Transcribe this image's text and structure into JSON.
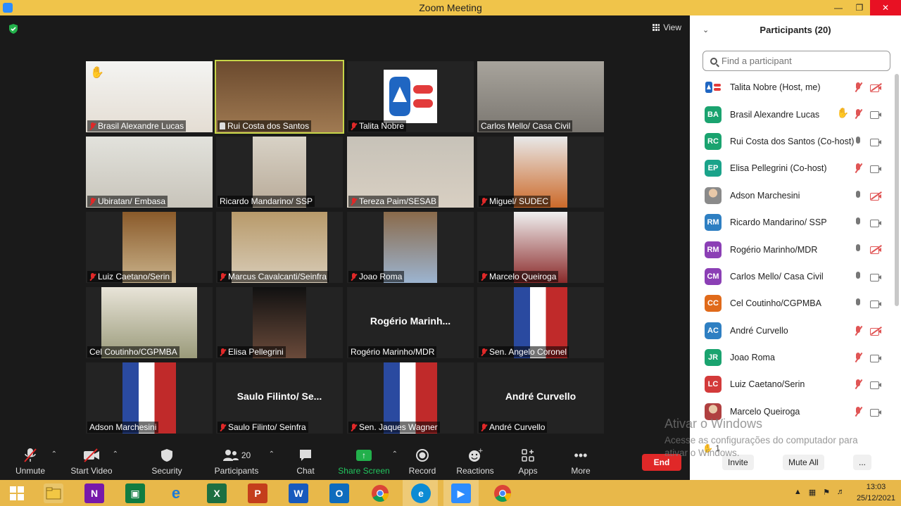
{
  "window": {
    "title": "Zoom Meeting"
  },
  "view_label": "View",
  "tiles": [
    {
      "name": "Brasil Alexandre Lucas",
      "muted": true,
      "hand": true
    },
    {
      "name": "Rui Costa dos Santos",
      "muted": false,
      "pinned": true,
      "active": true
    },
    {
      "name": "Talita Nobre",
      "muted": true,
      "logo": true
    },
    {
      "name": "Carlos Mello/ Casa Civil",
      "muted": false
    },
    {
      "name": "Ubiratan/ Embasa",
      "muted": true
    },
    {
      "name": "Ricardo Mandarino/ SSP",
      "muted": false
    },
    {
      "name": "Tereza Paim/SESAB",
      "muted": true
    },
    {
      "name": "Miguel/ SUDEC",
      "muted": true
    },
    {
      "name": "Luiz Caetano/Serin",
      "muted": true
    },
    {
      "name": "Marcus Cavalcanti/Seinfra",
      "muted": true
    },
    {
      "name": "Joao Roma",
      "muted": true
    },
    {
      "name": "Marcelo Queiroga",
      "muted": true
    },
    {
      "name": "Cel Coutinho/CGPMBA",
      "muted": false
    },
    {
      "name": "Elisa Pellegrini",
      "muted": true
    },
    {
      "name": "Rogério Marinho/MDR",
      "muted": false,
      "big_name": "Rogério  Marinh..."
    },
    {
      "name": "Sen. Angelo Coronel",
      "muted": true
    },
    {
      "name": "Adson Marchesini",
      "muted": false
    },
    {
      "name": "Saulo Filinto/ Seinfra",
      "muted": true,
      "big_name": "Saulo  Filinto/  Se..."
    },
    {
      "name": "Sen. Jaques Wagner",
      "muted": true
    },
    {
      "name": "André Curvello",
      "muted": true,
      "big_name": "André Curvello"
    }
  ],
  "toolbar": {
    "unmute": "Unmute",
    "start_video": "Start Video",
    "security": "Security",
    "participants": "Participants",
    "participants_count": "20",
    "chat": "Chat",
    "share_screen": "Share Screen",
    "record": "Record",
    "reactions": "Reactions",
    "apps": "Apps",
    "more": "More",
    "end": "End"
  },
  "panel": {
    "title": "Participants (20)",
    "search_placeholder": "Find a participant",
    "invite": "Invite",
    "mute_all": "Mute All",
    "more": "...",
    "raised_count": "1",
    "participants": [
      {
        "initials": "",
        "name": "Talita Nobre (Host, me)",
        "color": "#1f5fbf",
        "logo": true,
        "mic": "off",
        "cam": "off"
      },
      {
        "initials": "BA",
        "name": "Brasil Alexandre Lucas",
        "color": "#1aa36f",
        "hand": true,
        "mic": "off",
        "cam": "on"
      },
      {
        "initials": "RC",
        "name": "Rui Costa dos Santos (Co-host)",
        "color": "#1aa36f",
        "mic": "on",
        "cam": "on"
      },
      {
        "initials": "EP",
        "name": "Elisa Pellegrini (Co-host)",
        "color": "#1aa38a",
        "mic": "off",
        "cam": "on"
      },
      {
        "initials": "",
        "name": "Adson Marchesini",
        "color": "#8a8a8a",
        "photo": true,
        "mic": "on",
        "cam": "off"
      },
      {
        "initials": "RM",
        "name": "Ricardo Mandarino/ SSP",
        "color": "#2e7fc2",
        "mic": "on",
        "cam": "on"
      },
      {
        "initials": "RM",
        "name": "Rogério Marinho/MDR",
        "color": "#8b3fb5",
        "mic": "on",
        "cam": "off"
      },
      {
        "initials": "CM",
        "name": "Carlos Mello/ Casa Civil",
        "color": "#8b3fb5",
        "mic": "on",
        "cam": "on"
      },
      {
        "initials": "CC",
        "name": "Cel Coutinho/CGPMBA",
        "color": "#e06a1a",
        "mic": "on",
        "cam": "on"
      },
      {
        "initials": "AC",
        "name": "André Curvello",
        "color": "#2e7fc2",
        "mic": "off",
        "cam": "off"
      },
      {
        "initials": "JR",
        "name": "Joao Roma",
        "color": "#1aa36f",
        "mic": "off",
        "cam": "on"
      },
      {
        "initials": "LC",
        "name": "Luiz Caetano/Serin",
        "color": "#d33a3a",
        "mic": "off",
        "cam": "on"
      },
      {
        "initials": "",
        "name": "Marcelo Queiroga",
        "color": "#b04040",
        "photo": true,
        "mic": "off",
        "cam": "on"
      }
    ]
  },
  "watermark": {
    "line1": "Ativar o Windows",
    "line2": "Acesse as configurações do computador para",
    "line3": "ativar o Windows."
  },
  "taskbar": {
    "time": "13:03",
    "date": "25/12/2021"
  }
}
